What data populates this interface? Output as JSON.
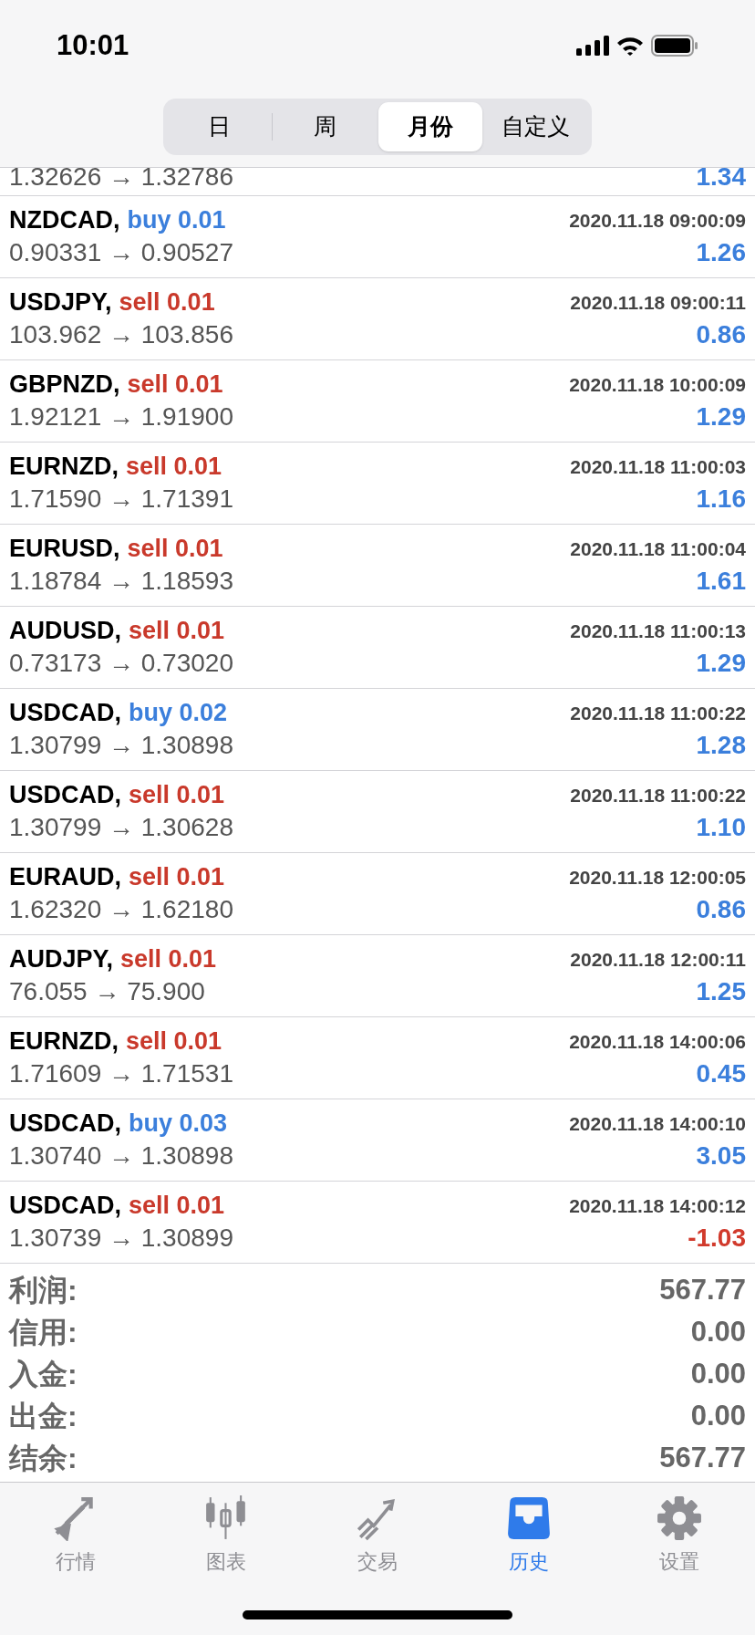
{
  "status_bar": {
    "time": "10:01"
  },
  "period_tabs": [
    {
      "label": "日",
      "selected": false
    },
    {
      "label": "周",
      "selected": false
    },
    {
      "label": "月份",
      "selected": true
    },
    {
      "label": "自定义",
      "selected": false
    }
  ],
  "clipped_row": {
    "prices": "1.32626 → 1.32786",
    "profit": "1.34",
    "loss": false
  },
  "trades": [
    {
      "symbol": "NZDCAD,",
      "order": "buy 0.01",
      "kind": "buy",
      "time": "2020.11.18 09:00:09",
      "prices": "0.90331 → 0.90527",
      "profit": "1.26",
      "loss": false
    },
    {
      "symbol": "USDJPY,",
      "order": "sell 0.01",
      "kind": "sell",
      "time": "2020.11.18 09:00:11",
      "prices": "103.962 → 103.856",
      "profit": "0.86",
      "loss": false
    },
    {
      "symbol": "GBPNZD,",
      "order": "sell 0.01",
      "kind": "sell",
      "time": "2020.11.18 10:00:09",
      "prices": "1.92121 → 1.91900",
      "profit": "1.29",
      "loss": false
    },
    {
      "symbol": "EURNZD,",
      "order": "sell 0.01",
      "kind": "sell",
      "time": "2020.11.18 11:00:03",
      "prices": "1.71590 → 1.71391",
      "profit": "1.16",
      "loss": false
    },
    {
      "symbol": "EURUSD,",
      "order": "sell 0.01",
      "kind": "sell",
      "time": "2020.11.18 11:00:04",
      "prices": "1.18784 → 1.18593",
      "profit": "1.61",
      "loss": false
    },
    {
      "symbol": "AUDUSD,",
      "order": "sell 0.01",
      "kind": "sell",
      "time": "2020.11.18 11:00:13",
      "prices": "0.73173 → 0.73020",
      "profit": "1.29",
      "loss": false
    },
    {
      "symbol": "USDCAD,",
      "order": "buy 0.02",
      "kind": "buy",
      "time": "2020.11.18 11:00:22",
      "prices": "1.30799 → 1.30898",
      "profit": "1.28",
      "loss": false
    },
    {
      "symbol": "USDCAD,",
      "order": "sell 0.01",
      "kind": "sell",
      "time": "2020.11.18 11:00:22",
      "prices": "1.30799 → 1.30628",
      "profit": "1.10",
      "loss": false
    },
    {
      "symbol": "EURAUD,",
      "order": "sell 0.01",
      "kind": "sell",
      "time": "2020.11.18 12:00:05",
      "prices": "1.62320 → 1.62180",
      "profit": "0.86",
      "loss": false
    },
    {
      "symbol": "AUDJPY,",
      "order": "sell 0.01",
      "kind": "sell",
      "time": "2020.11.18 12:00:11",
      "prices": "76.055 → 75.900",
      "profit": "1.25",
      "loss": false
    },
    {
      "symbol": "EURNZD,",
      "order": "sell 0.01",
      "kind": "sell",
      "time": "2020.11.18 14:00:06",
      "prices": "1.71609 → 1.71531",
      "profit": "0.45",
      "loss": false
    },
    {
      "symbol": "USDCAD,",
      "order": "buy 0.03",
      "kind": "buy",
      "time": "2020.11.18 14:00:10",
      "prices": "1.30740 → 1.30898",
      "profit": "3.05",
      "loss": false
    },
    {
      "symbol": "USDCAD,",
      "order": "sell 0.01",
      "kind": "sell",
      "time": "2020.11.18 14:00:12",
      "prices": "1.30739 → 1.30899",
      "profit": "-1.03",
      "loss": true
    }
  ],
  "summary": [
    {
      "label": "利润:",
      "value": "567.77"
    },
    {
      "label": "信用:",
      "value": "0.00"
    },
    {
      "label": "入金:",
      "value": "0.00"
    },
    {
      "label": "出金:",
      "value": "0.00"
    },
    {
      "label": "结余:",
      "value": "567.77"
    }
  ],
  "tab_bar": [
    {
      "label": "行情",
      "kind": "quotes",
      "selected": false
    },
    {
      "label": "图表",
      "kind": "chart",
      "selected": false
    },
    {
      "label": "交易",
      "kind": "trade",
      "selected": false
    },
    {
      "label": "历史",
      "kind": "history",
      "selected": true
    },
    {
      "label": "设置",
      "kind": "settings",
      "selected": false
    }
  ]
}
